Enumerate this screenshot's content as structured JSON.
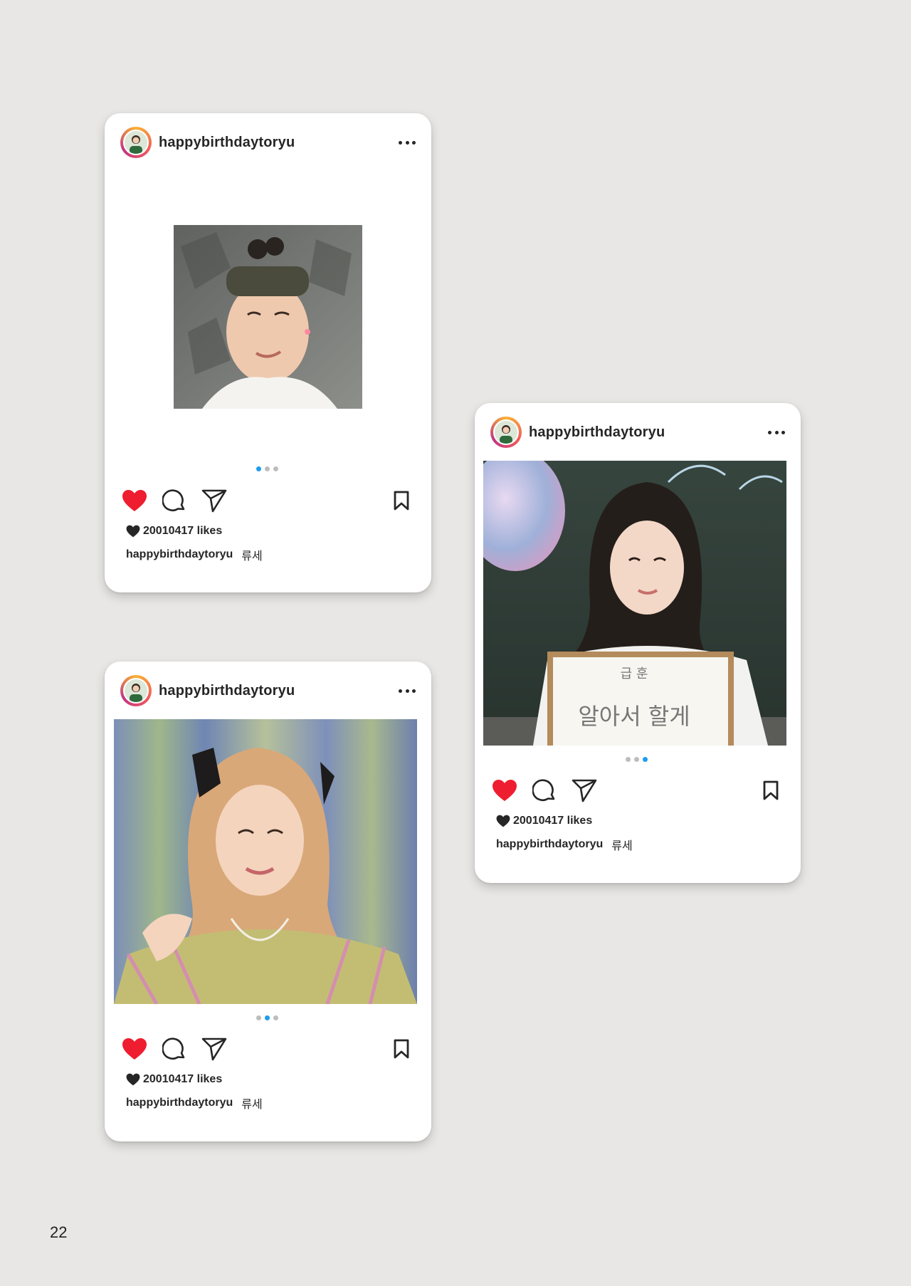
{
  "page": {
    "number": "22"
  },
  "posts": [
    {
      "username": "happybirthdaytoryu",
      "likes": "20010417 likes",
      "caption_user": "happybirthdaytoryu",
      "caption_text": "류세",
      "active_slide": 1,
      "slide_count": 3
    },
    {
      "username": "happybirthdaytoryu",
      "likes": "20010417 likes",
      "caption_user": "happybirthdaytoryu",
      "caption_text": "류세",
      "active_slide": 3,
      "slide_count": 3,
      "photo_board_text": [
        "급 훈",
        "알아서 할게"
      ]
    },
    {
      "username": "happybirthdaytoryu",
      "likes": "20010417 likes",
      "caption_user": "happybirthdaytoryu",
      "caption_text": "류세",
      "active_slide": 2,
      "slide_count": 3
    }
  ],
  "colors": {
    "background": "#e8e7e5",
    "like_red": "#ee1d2f",
    "active_dot": "#1f9cf0",
    "inactive_dot": "#bdbdbd"
  },
  "icons": [
    "more-icon",
    "heart-icon",
    "comment-icon",
    "share-icon",
    "bookmark-icon",
    "small-heart-icon"
  ]
}
